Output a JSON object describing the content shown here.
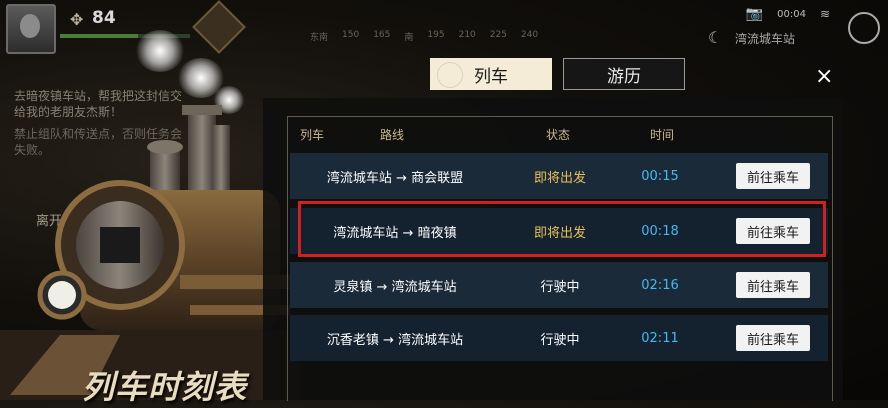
{
  "hud": {
    "level": "84",
    "compass_marks": [
      "东南",
      "150",
      "165",
      "南",
      "195",
      "210",
      "225",
      "240"
    ],
    "clock": "00:04",
    "location": "湾流城车站"
  },
  "quest": {
    "text": "去暗夜镇车站，帮我把这封信交给我的老朋友杰斯！",
    "warning": "禁止组队和传送点，否则任务会失败。",
    "leave_label": "离开"
  },
  "tabs": [
    {
      "label": "列车",
      "active": true
    },
    {
      "label": "游历",
      "active": false
    }
  ],
  "close_icon": "×",
  "table": {
    "headers": {
      "train": "列车",
      "route": "路线",
      "status": "状态",
      "time": "时间"
    },
    "rows": [
      {
        "route": "湾流城车站 → 商会联盟",
        "status": "即将出发",
        "status_color": "#e8c05a",
        "time": "00:15",
        "action": "前往乘车"
      },
      {
        "route": "湾流城车站 → 暗夜镇",
        "status": "即将出发",
        "status_color": "#e8c05a",
        "time": "00:18",
        "action": "前往乘车"
      },
      {
        "route": "灵泉镇 → 湾流城车站",
        "status": "行驶中",
        "status_color": "#ffffff",
        "time": "02:16",
        "action": "前往乘车"
      },
      {
        "route": "沉香老镇 → 湾流城车站",
        "status": "行驶中",
        "status_color": "#ffffff",
        "time": "02:11",
        "action": "前往乘车"
      }
    ]
  },
  "banner_title": "列车时刻表",
  "colors": {
    "accent_time": "#45b8ef",
    "departing": "#e8c05a",
    "highlight": "#d21f1f"
  }
}
